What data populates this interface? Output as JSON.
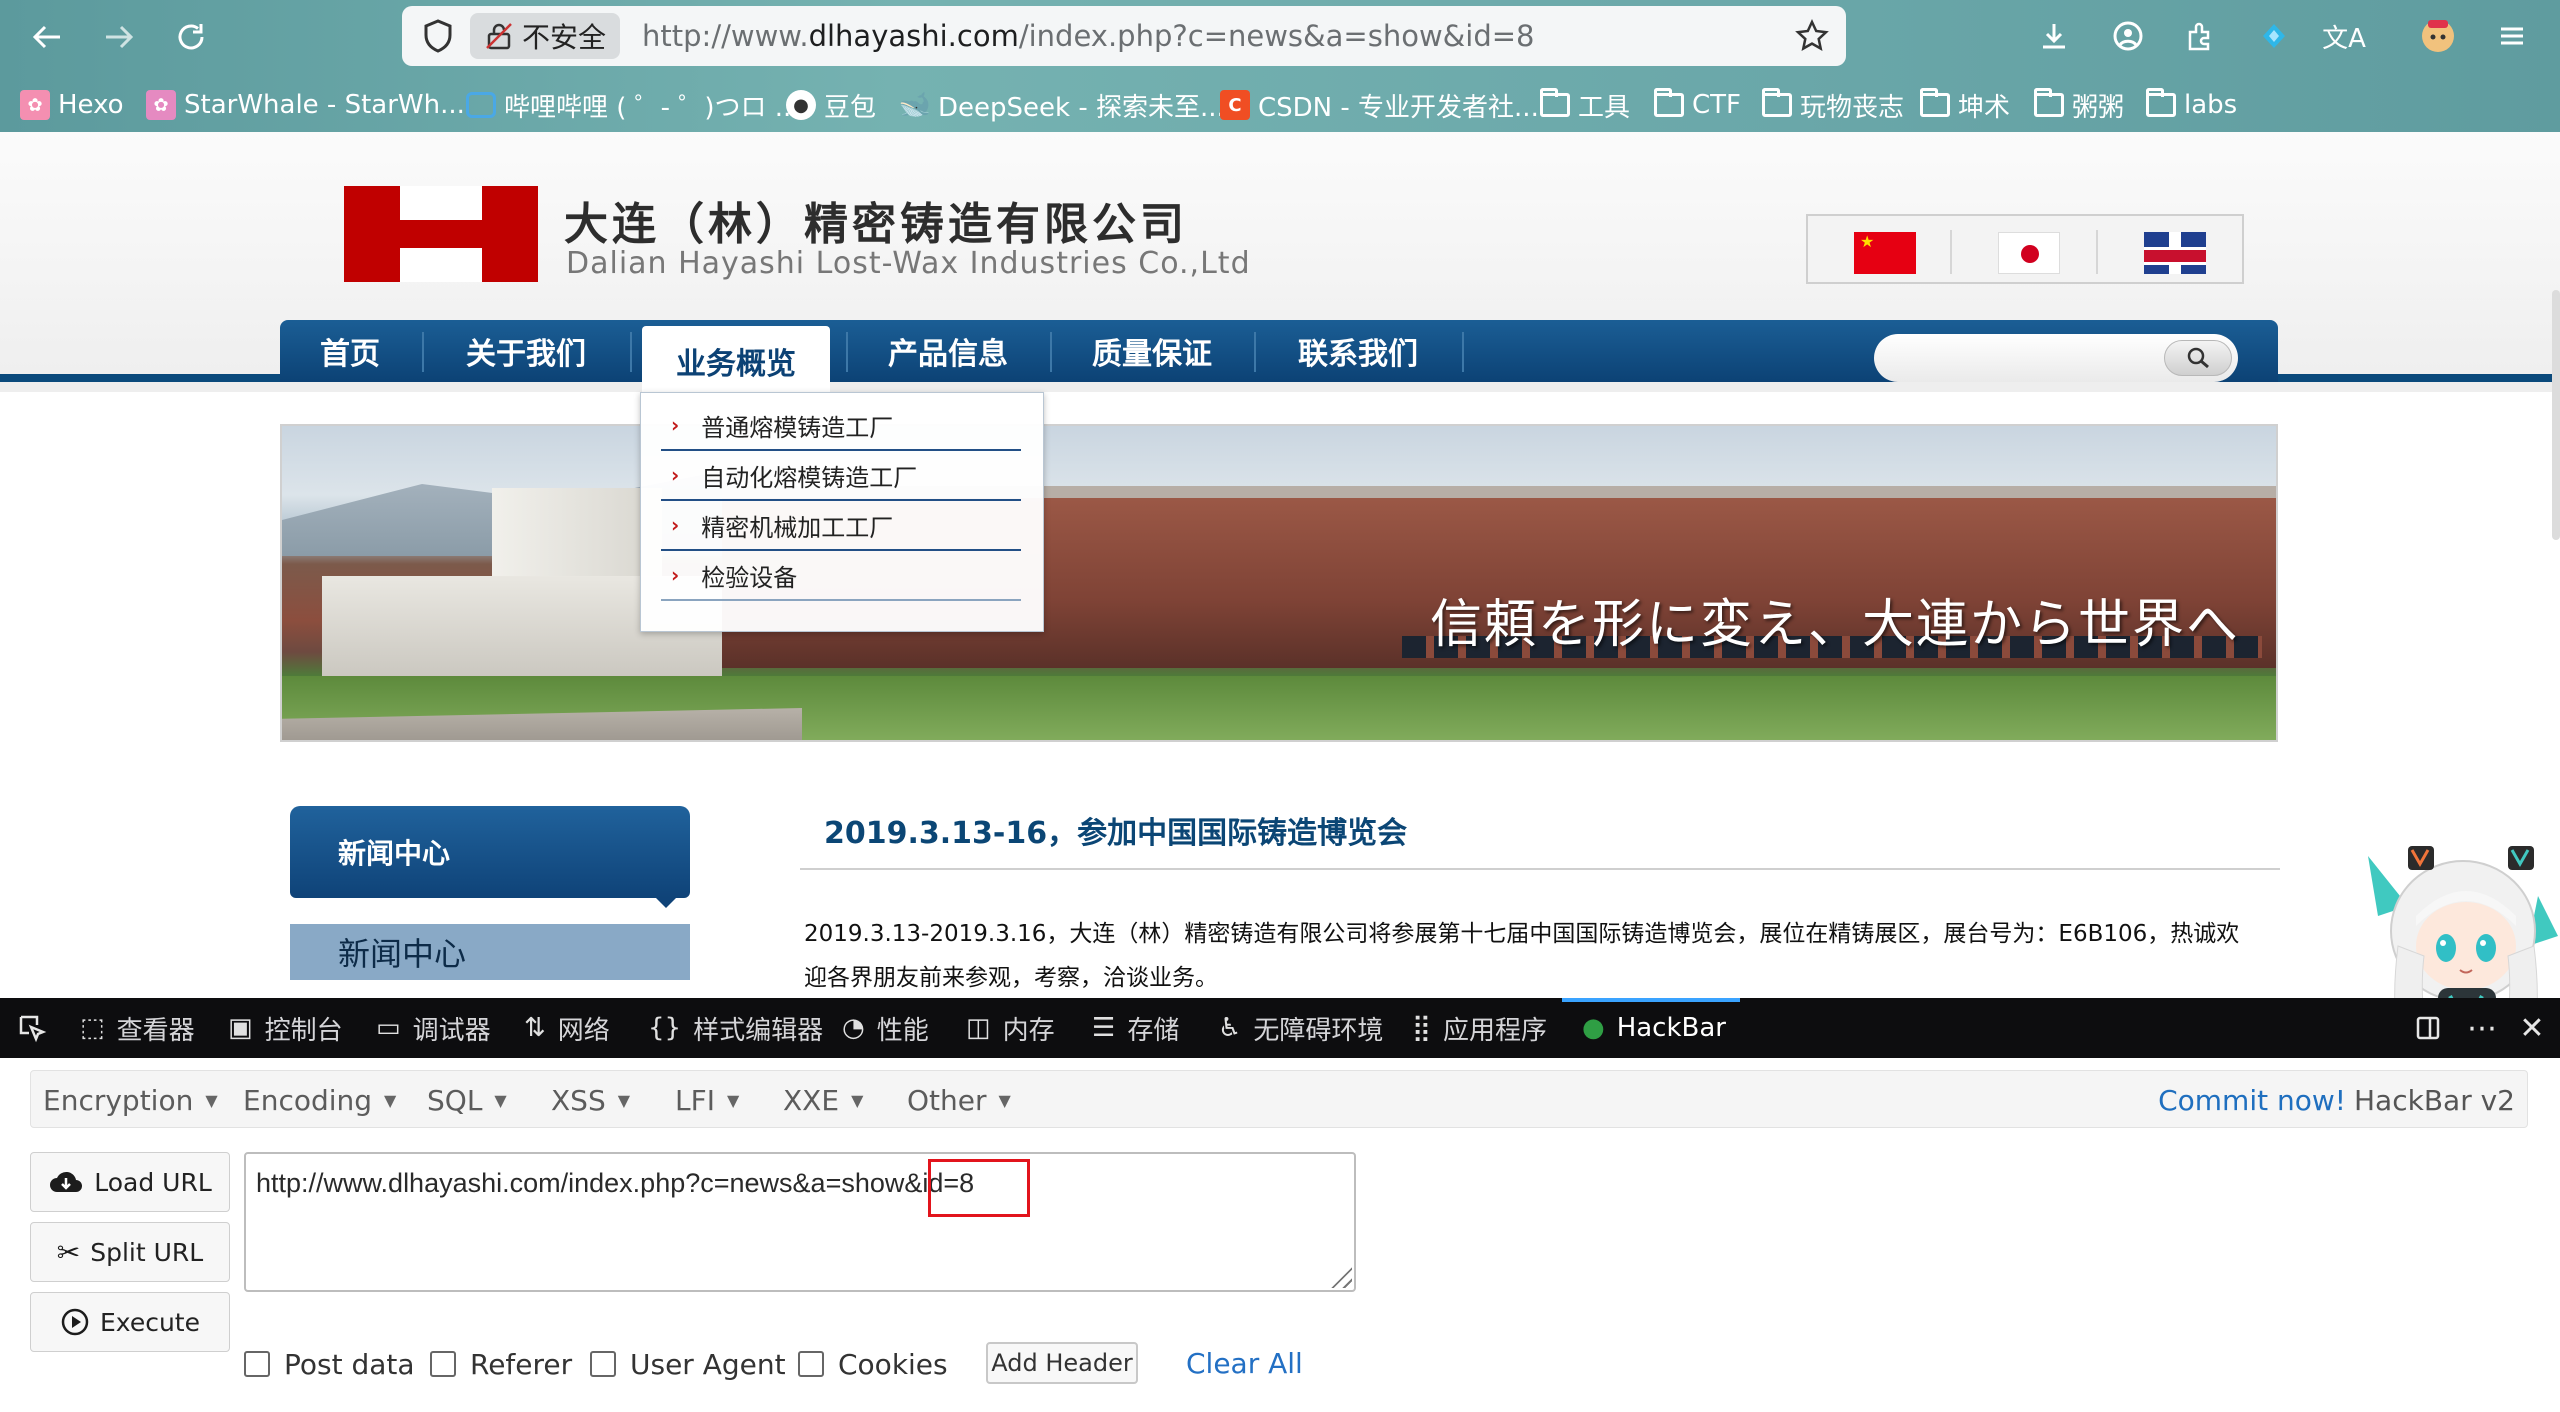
{
  "browser": {
    "url_prefix": "http://www.",
    "url_domain": "dlhayashi.com",
    "url_path": "/index.php?c=news&a=show&id=8",
    "security_label": "不安全",
    "bookmarks": [
      {
        "label": "Hexo",
        "icon": "hexo-icon"
      },
      {
        "label": "StarWhale - StarWh...",
        "icon": "starwhale-icon"
      },
      {
        "label": "哔哩哔哩 ( ゜- ゜)つロ ...",
        "icon": "bilibili-icon"
      },
      {
        "label": "豆包",
        "icon": "doubao-icon"
      },
      {
        "label": "DeepSeek - 探索未至...",
        "icon": "deepseek-icon"
      },
      {
        "label": "CSDN - 专业开发者社...",
        "icon": "csdn-icon"
      },
      {
        "label": "工具",
        "icon": "folder-icon"
      },
      {
        "label": "CTF",
        "icon": "folder-icon"
      },
      {
        "label": "玩物丧志",
        "icon": "folder-icon"
      },
      {
        "label": "坤术",
        "icon": "folder-icon"
      },
      {
        "label": "粥粥",
        "icon": "folder-icon"
      },
      {
        "label": "labs",
        "icon": "folder-icon"
      }
    ]
  },
  "site": {
    "company_cn": "大连（林）精密铸造有限公司",
    "company_en": "Dalian Hayashi Lost-Wax Industries Co.,Ltd",
    "nav": [
      "首页",
      "关于我们",
      "业务概览",
      "产品信息",
      "质量保证",
      "联系我们"
    ],
    "nav_active_index": 2,
    "dropdown": [
      "普通熔模铸造工厂",
      "自动化熔模铸造工厂",
      "精密机械加工工厂",
      "检验设备"
    ],
    "banner_text": "信頼を形に変え、大連から世界へ",
    "sidebar_title": "新闻中心",
    "sidebar_item": "新闻中心",
    "article_title": "2019.3.13-16，参加中国国际铸造博览会",
    "article_line1": "2019.3.13-2019.3.16，大连（林）精密铸造有限公司将参展第十七届中国国际铸造博览会，展位在精铸展区，展台号为：E6B106，热诚欢",
    "article_line2": "迎各界朋友前来参观，考察，洽谈业务。"
  },
  "devtools": {
    "tabs": [
      {
        "label": "查看器",
        "icon": "inspector-icon"
      },
      {
        "label": "控制台",
        "icon": "console-icon"
      },
      {
        "label": "调试器",
        "icon": "debugger-icon"
      },
      {
        "label": "网络",
        "icon": "network-icon"
      },
      {
        "label": "样式编辑器",
        "icon": "style-editor-icon"
      },
      {
        "label": "性能",
        "icon": "performance-icon"
      },
      {
        "label": "内存",
        "icon": "memory-icon"
      },
      {
        "label": "存储",
        "icon": "storage-icon"
      },
      {
        "label": "无障碍环境",
        "icon": "accessibility-icon"
      },
      {
        "label": "应用程序",
        "icon": "application-icon"
      },
      {
        "label": "HackBar",
        "icon": "hackbar-icon"
      }
    ],
    "active_tab": "HackBar"
  },
  "hackbar": {
    "menus": [
      "Encryption",
      "Encoding",
      "SQL",
      "XSS",
      "LFI",
      "XXE",
      "Other"
    ],
    "commit_link": "Commit now!",
    "version": "HackBar v2",
    "buttons": {
      "load": "Load URL",
      "split": "Split URL",
      "execute": "Execute"
    },
    "url_value": "http://www.dlhayashi.com/index.php?c=news&a=show&id=8",
    "checkboxes": [
      "Post data",
      "Referer",
      "User Agent",
      "Cookies"
    ],
    "add_header": "Add Header",
    "clear_all": "Clear All"
  }
}
